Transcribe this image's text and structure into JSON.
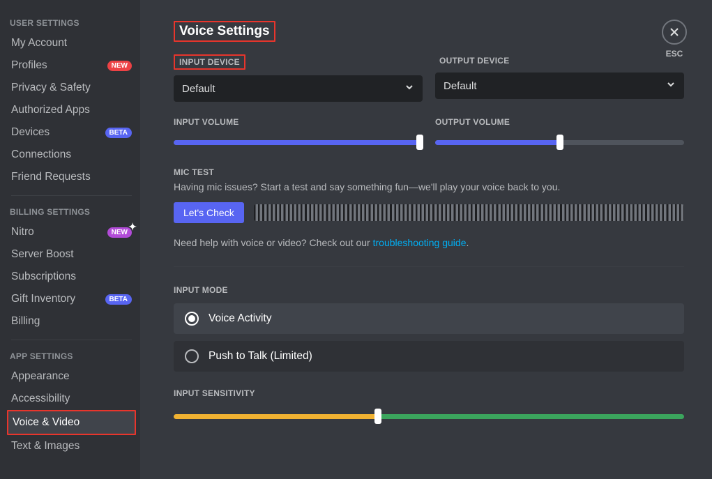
{
  "sidebar": {
    "sections": [
      {
        "header": "USER SETTINGS",
        "items": [
          {
            "label": "My Account",
            "badge": null,
            "active": false
          },
          {
            "label": "Profiles",
            "badge": "NEW",
            "badgeClass": "new",
            "active": false
          },
          {
            "label": "Privacy & Safety",
            "badge": null,
            "active": false
          },
          {
            "label": "Authorized Apps",
            "badge": null,
            "active": false
          },
          {
            "label": "Devices",
            "badge": "BETA",
            "badgeClass": "beta",
            "active": false
          },
          {
            "label": "Connections",
            "badge": null,
            "active": false
          },
          {
            "label": "Friend Requests",
            "badge": null,
            "active": false
          }
        ]
      },
      {
        "header": "BILLING SETTINGS",
        "items": [
          {
            "label": "Nitro",
            "badge": "NEW",
            "badgeClass": "nitro",
            "sparkle": true,
            "active": false
          },
          {
            "label": "Server Boost",
            "badge": null,
            "active": false
          },
          {
            "label": "Subscriptions",
            "badge": null,
            "active": false
          },
          {
            "label": "Gift Inventory",
            "badge": "BETA",
            "badgeClass": "beta",
            "active": false
          },
          {
            "label": "Billing",
            "badge": null,
            "active": false
          }
        ]
      },
      {
        "header": "APP SETTINGS",
        "items": [
          {
            "label": "Appearance",
            "badge": null,
            "active": false
          },
          {
            "label": "Accessibility",
            "badge": null,
            "active": false
          },
          {
            "label": "Voice & Video",
            "badge": null,
            "active": true,
            "highlight": true
          },
          {
            "label": "Text & Images",
            "badge": null,
            "active": false
          }
        ]
      }
    ]
  },
  "close_label": "ESC",
  "title": "Voice Settings",
  "input_device": {
    "label": "INPUT DEVICE",
    "value": "Default"
  },
  "output_device": {
    "label": "OUTPUT DEVICE",
    "value": "Default"
  },
  "input_volume": {
    "label": "INPUT VOLUME",
    "pct": 99
  },
  "output_volume": {
    "label": "OUTPUT VOLUME",
    "pct": 50
  },
  "mic_test": {
    "label": "MIC TEST",
    "desc": "Having mic issues? Start a test and say something fun—we'll play your voice back to you.",
    "button": "Let's Check"
  },
  "help": {
    "pre": "Need help with voice or video? Check out our ",
    "link": "troubleshooting guide",
    "post": "."
  },
  "input_mode": {
    "label": "INPUT MODE",
    "options": [
      {
        "label": "Voice Activity",
        "selected": true
      },
      {
        "label": "Push to Talk (Limited)",
        "selected": false
      }
    ]
  },
  "sensitivity": {
    "label": "INPUT SENSITIVITY",
    "pct": 40
  }
}
